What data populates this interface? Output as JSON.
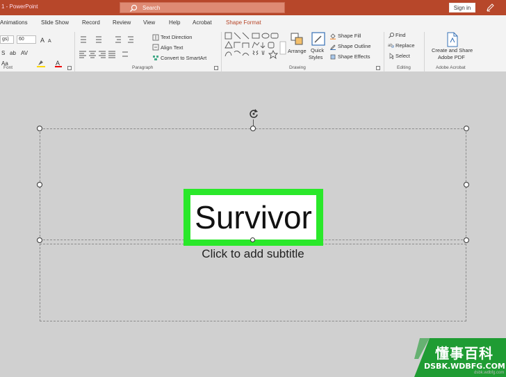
{
  "titlebar": {
    "doc_title": "1  -  PowerPoint",
    "search_placeholder": "Search",
    "signin": "Sign in"
  },
  "tabs": [
    {
      "label": "Animations",
      "active": false
    },
    {
      "label": "Slide Show",
      "active": false
    },
    {
      "label": "Record",
      "active": false
    },
    {
      "label": "Review",
      "active": false
    },
    {
      "label": "View",
      "active": false
    },
    {
      "label": "Help",
      "active": false
    },
    {
      "label": "Acrobat",
      "active": false
    },
    {
      "label": "Shape Format",
      "active": true
    }
  ],
  "ribbon": {
    "font": {
      "font_name": "gs)",
      "font_size": "60",
      "label": "Font"
    },
    "paragraph": {
      "text_direction": "Text Direction",
      "align_text": "Align Text",
      "convert_smartart": "Convert to SmartArt",
      "label": "Paragraph"
    },
    "drawing": {
      "arrange": "Arrange",
      "quick_styles_1": "Quick",
      "quick_styles_2": "Styles",
      "shape_fill": "Shape Fill",
      "shape_outline": "Shape Outline",
      "shape_effects": "Shape Effects",
      "label": "Drawing"
    },
    "editing": {
      "find": "Find",
      "replace": "Replace",
      "select": "Select",
      "label": "Editing"
    },
    "acrobat": {
      "create_share_1": "Create and Share",
      "create_share_2": "Adobe PDF",
      "label": "Adobe Acrobat"
    }
  },
  "slide": {
    "title": "Survivor",
    "subtitle_placeholder": "Click to add subtitle"
  },
  "watermark": {
    "title": "懂事百科",
    "domain": "DSBK.WDBFG.COM",
    "small": "dsbk.wdbfg.com"
  },
  "colors": {
    "accent": "#b7472a",
    "highlight": "#2ae82a"
  }
}
